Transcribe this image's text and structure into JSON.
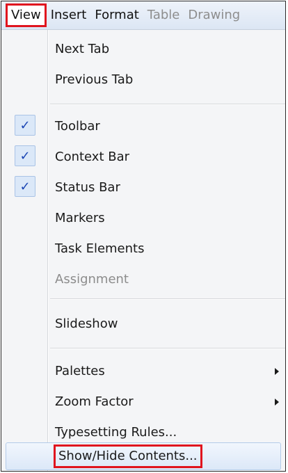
{
  "menubar": {
    "items": [
      {
        "label": "View",
        "state": "active"
      },
      {
        "label": "Insert",
        "state": "enabled"
      },
      {
        "label": "Format",
        "state": "enabled"
      },
      {
        "label": "Table",
        "state": "disabled"
      },
      {
        "label": "Drawing",
        "state": "disabled"
      }
    ]
  },
  "view_menu": {
    "items": [
      {
        "label": "Next Tab"
      },
      {
        "label": "Previous Tab"
      },
      {
        "label": "Toolbar",
        "checked": true
      },
      {
        "label": "Context Bar",
        "checked": true
      },
      {
        "label": "Status Bar",
        "checked": true
      },
      {
        "label": "Markers"
      },
      {
        "label": "Task Elements"
      },
      {
        "label": "Assignment",
        "disabled": true
      },
      {
        "label": "Slideshow"
      },
      {
        "label": "Palettes",
        "submenu": true
      },
      {
        "label": "Zoom Factor",
        "submenu": true
      },
      {
        "label": "Typesetting Rules..."
      },
      {
        "label": "Show/Hide Contents...",
        "highlighted": true
      }
    ],
    "check_glyph": "✓"
  },
  "colors": {
    "annotation_red": "#e0141e",
    "check_blue": "#1b46b4",
    "disabled_gray": "#8c8c8c"
  }
}
